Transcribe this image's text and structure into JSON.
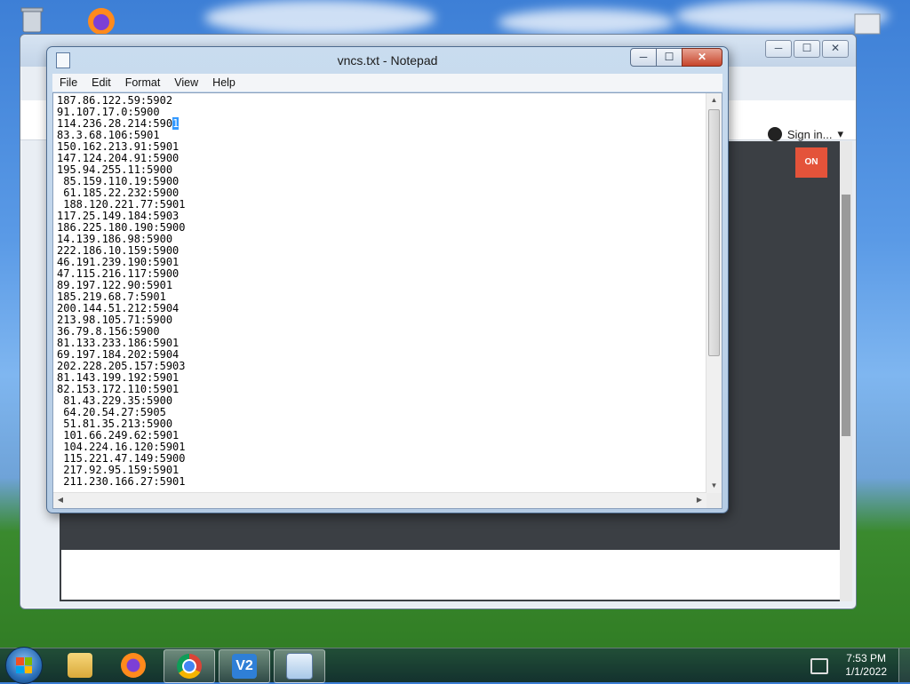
{
  "desktop": {
    "icons": [
      "recycle-bin-icon",
      "firefox-icon"
    ]
  },
  "browser": {
    "sign_in_label": "Sign in...",
    "button_label": "ON",
    "win_buttons": [
      "─",
      "☐",
      "✕"
    ]
  },
  "notepad": {
    "title": "vncs.txt - Notepad",
    "menu": [
      "File",
      "Edit",
      "Format",
      "View",
      "Help"
    ],
    "buttons": {
      "minimize": "─",
      "maximize": "☐",
      "close": "✕"
    },
    "lines": [
      "187.86.122.59:5902",
      "91.107.17.0:5900",
      "114.236.28.214:590",
      "83.3.68.106:5901",
      "150.162.213.91:5901",
      "147.124.204.91:5900",
      "195.94.255.11:5900",
      " 85.159.110.19:5900",
      " 61.185.22.232:5900",
      " 188.120.221.77:5901",
      "117.25.149.184:5903",
      "186.225.180.190:5900",
      "14.139.186.98:5900",
      "222.186.10.159:5900",
      "46.191.239.190:5901",
      "47.115.216.117:5900",
      "89.197.122.90:5901",
      "185.219.68.7:5901",
      "200.144.51.212:5904",
      "213.98.105.71:5900",
      "36.79.8.156:5900",
      "81.133.233.186:5901",
      "69.197.184.202:5904",
      "202.228.205.157:5903",
      "81.143.199.192:5901",
      "82.153.172.110:5901",
      " 81.43.229.35:5900",
      " 64.20.54.27:5905",
      " 51.81.35.213:5900",
      " 101.66.249.62:5901",
      " 104.224.16.120:5901",
      " 115.221.47.149:5900",
      " 217.92.95.159:5901",
      " 211.230.166.27:5901"
    ],
    "selected_fragment": "1"
  },
  "taskbar": {
    "items": [
      {
        "name": "file-explorer",
        "icon": "folder-icon",
        "active": false
      },
      {
        "name": "firefox",
        "icon": "firefox-icon",
        "active": false
      },
      {
        "name": "chrome",
        "icon": "chrome-icon",
        "active": true
      },
      {
        "name": "vnc-viewer",
        "icon": "vnc-icon",
        "label": "V2",
        "active": true
      },
      {
        "name": "notepad",
        "icon": "notepad-icon",
        "active": true
      }
    ],
    "time": "7:53 PM",
    "date": "1/1/2022"
  }
}
